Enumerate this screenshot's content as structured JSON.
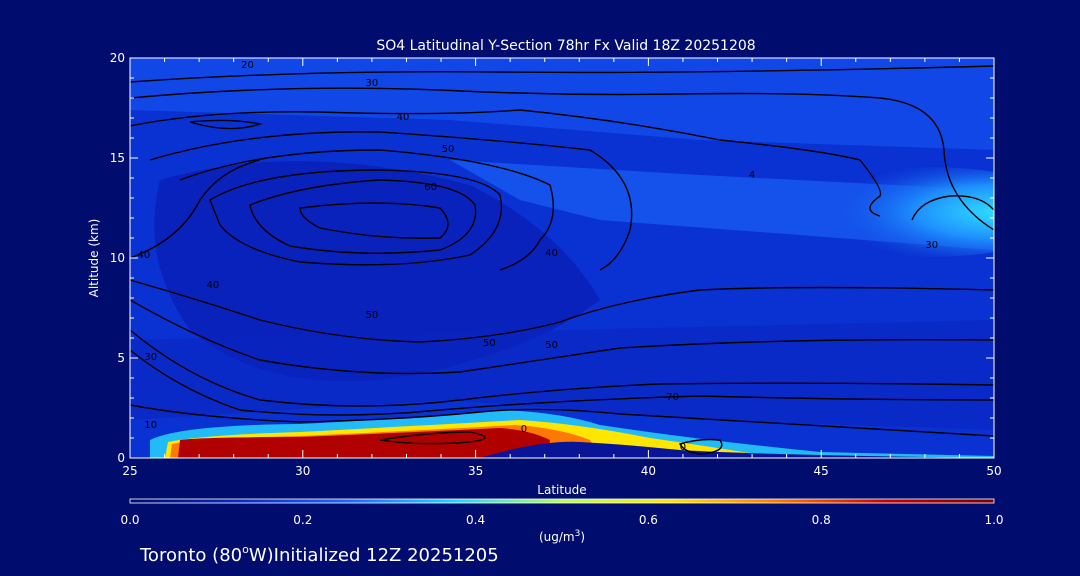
{
  "chart_data": {
    "type": "heatmap",
    "title": "SO4 Latitudinal Y-Section 78hr  Fx Valid 18Z 20251208",
    "xlabel": "Latitude",
    "ylabel": "Altitude (km)",
    "xlim": [
      25,
      50
    ],
    "ylim": [
      0,
      20
    ],
    "x_ticks": [
      "25",
      "30",
      "35",
      "40",
      "45",
      "50"
    ],
    "y_ticks": [
      "0",
      "5",
      "10",
      "15",
      "20"
    ],
    "grid": false,
    "colorbar": {
      "min": 0.0,
      "max": 1.0,
      "ticks": [
        "0.0",
        "0.2",
        "0.4",
        "0.6",
        "0.8",
        "1.0"
      ],
      "units_prefix": "(ug/m",
      "units_sup": "3",
      "units_suffix": ")",
      "colors": [
        "#000c6e",
        "#0a28c8",
        "#1e64ff",
        "#28d2ff",
        "#b4ff5a",
        "#ffe600",
        "#ff7800",
        "#c80000",
        "#7a0000"
      ]
    },
    "field_regions": [
      {
        "name": "near-surface",
        "lat": [
          26,
          44
        ],
        "alt": [
          0,
          0.9
        ],
        "value": 1.0
      },
      {
        "name": "upper-plume",
        "lat": [
          45,
          50
        ],
        "alt": [
          11,
          13.5
        ],
        "value": 0.45
      }
    ],
    "contour_labels": [
      {
        "text": "20",
        "lat": 28.4,
        "alt": 19.7
      },
      {
        "text": "30",
        "lat": 32.0,
        "alt": 18.8
      },
      {
        "text": "40",
        "lat": 32.9,
        "alt": 17.1
      },
      {
        "text": "50",
        "lat": 34.2,
        "alt": 15.5
      },
      {
        "text": "60",
        "lat": 33.7,
        "alt": 13.6
      },
      {
        "text": "40",
        "lat": 37.2,
        "alt": 10.3
      },
      {
        "text": "40",
        "lat": 25.4,
        "alt": 10.2
      },
      {
        "text": "40",
        "lat": 27.4,
        "alt": 8.7
      },
      {
        "text": "50",
        "lat": 32.0,
        "alt": 7.2
      },
      {
        "text": "50",
        "lat": 35.4,
        "alt": 5.8
      },
      {
        "text": "50",
        "lat": 37.2,
        "alt": 5.7
      },
      {
        "text": "30",
        "lat": 25.6,
        "alt": 5.1
      },
      {
        "text": "70",
        "lat": 40.7,
        "alt": 3.1
      },
      {
        "text": "10",
        "lat": 25.6,
        "alt": 1.7
      },
      {
        "text": "0",
        "lat": 36.4,
        "alt": 1.5
      },
      {
        "text": "0",
        "lat": 41.0,
        "alt": 0.6
      },
      {
        "text": "30",
        "lat": 48.2,
        "alt": 10.7
      },
      {
        "text": "4",
        "lat": 43.0,
        "alt": 14.2
      }
    ]
  },
  "footer": {
    "location_text": "Toronto (80",
    "degree_symbol": "o",
    "location_suffix": "W)",
    "initialized_text": "Initialized 12Z 20251205"
  }
}
